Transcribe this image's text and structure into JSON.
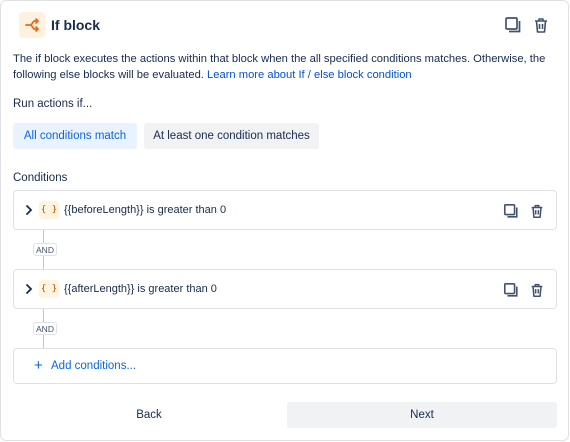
{
  "header": {
    "title": "If block",
    "icon": "branch-icon",
    "accent_color": "#e56910"
  },
  "description": {
    "text": "The if block executes the actions within that block when the all specified conditions matches. Otherwise, the following else blocks will be evaluated.",
    "link_text": "Learn more about If / else block condition"
  },
  "run_actions": {
    "label": "Run actions if...",
    "options": [
      "All conditions match",
      "At least one condition matches"
    ],
    "selected": "All conditions match"
  },
  "conditions": {
    "label": "Conditions",
    "items": [
      {
        "text": "{{beforeLength}} is greater than 0",
        "icon_label": "{ }"
      },
      {
        "text": "{{afterLength}} is greater than 0",
        "icon_label": "{ }"
      }
    ],
    "connector": "AND",
    "add_label": "Add conditions..."
  },
  "footer": {
    "back_label": "Back",
    "next_label": "Next"
  }
}
